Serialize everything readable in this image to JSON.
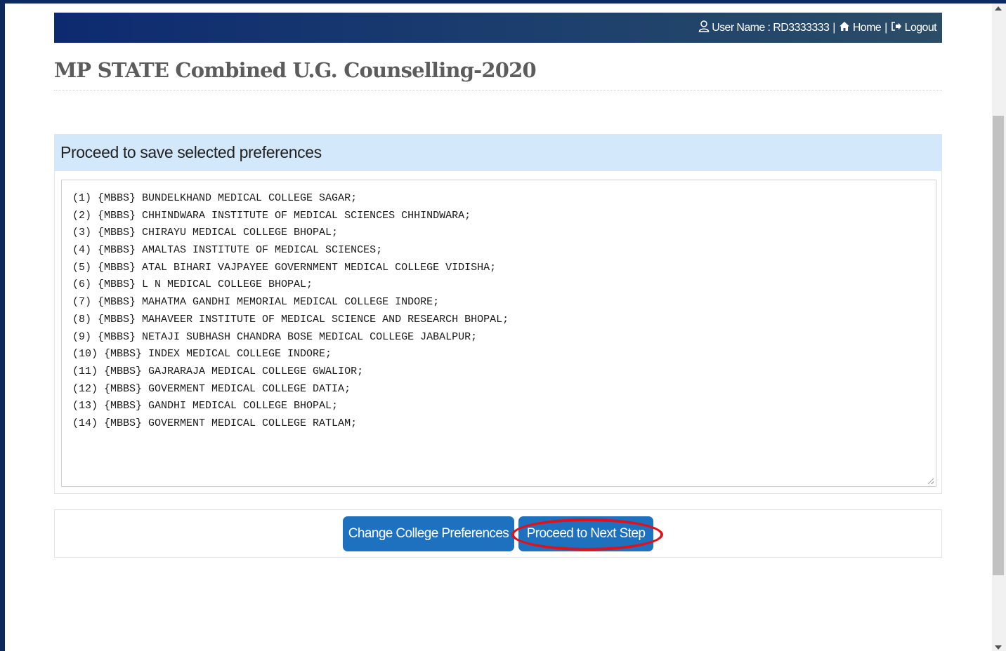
{
  "header": {
    "user_label": "User Name : RD3333333",
    "separator": "|",
    "home_label": "Home",
    "logout_label": "Logout"
  },
  "page": {
    "title": "MP STATE Combined U.G. Counselling-2020"
  },
  "panel": {
    "heading": "Proceed to save selected preferences",
    "preferences": [
      "(1) {MBBS} BUNDELKHAND MEDICAL COLLEGE SAGAR;",
      "(2) {MBBS} CHHINDWARA INSTITUTE OF MEDICAL SCIENCES CHHINDWARA;",
      "(3) {MBBS} CHIRAYU MEDICAL COLLEGE BHOPAL;",
      "(4) {MBBS} AMALTAS INSTITUTE OF MEDICAL SCIENCES;",
      "(5) {MBBS} ATAL BIHARI VAJPAYEE GOVERNMENT MEDICAL COLLEGE VIDISHA;",
      "(6) {MBBS} L N MEDICAL COLLEGE BHOPAL;",
      "(7) {MBBS} MAHATMA GANDHI MEMORIAL MEDICAL COLLEGE INDORE;",
      "(8) {MBBS} MAHAVEER INSTITUTE OF MEDICAL SCIENCE AND RESEARCH BHOPAL;",
      "(9) {MBBS} NETAJI SUBHASH CHANDRA BOSE MEDICAL COLLEGE JABALPUR;",
      "(10) {MBBS} INDEX MEDICAL COLLEGE INDORE;",
      "(11) {MBBS} GAJRARAJA MEDICAL COLLEGE GWALIOR;",
      "(12) {MBBS} GOVERMENT MEDICAL COLLEGE DATIA;",
      "(13) {MBBS} GANDHI MEDICAL COLLEGE BHOPAL;",
      "(14) {MBBS} GOVERMENT MEDICAL COLLEGE RATLAM;"
    ]
  },
  "actions": {
    "change_label": "Change College Preferences",
    "next_label": "Proceed to Next Step"
  },
  "icons": {
    "user": "user-icon",
    "home": "home-icon",
    "logout": "logout-icon"
  },
  "colors": {
    "header_start": "#0d2a70",
    "panel_heading_bg": "#d3e8fb",
    "button_bg": "#1d71bf",
    "highlight_ring": "#e0111a"
  }
}
